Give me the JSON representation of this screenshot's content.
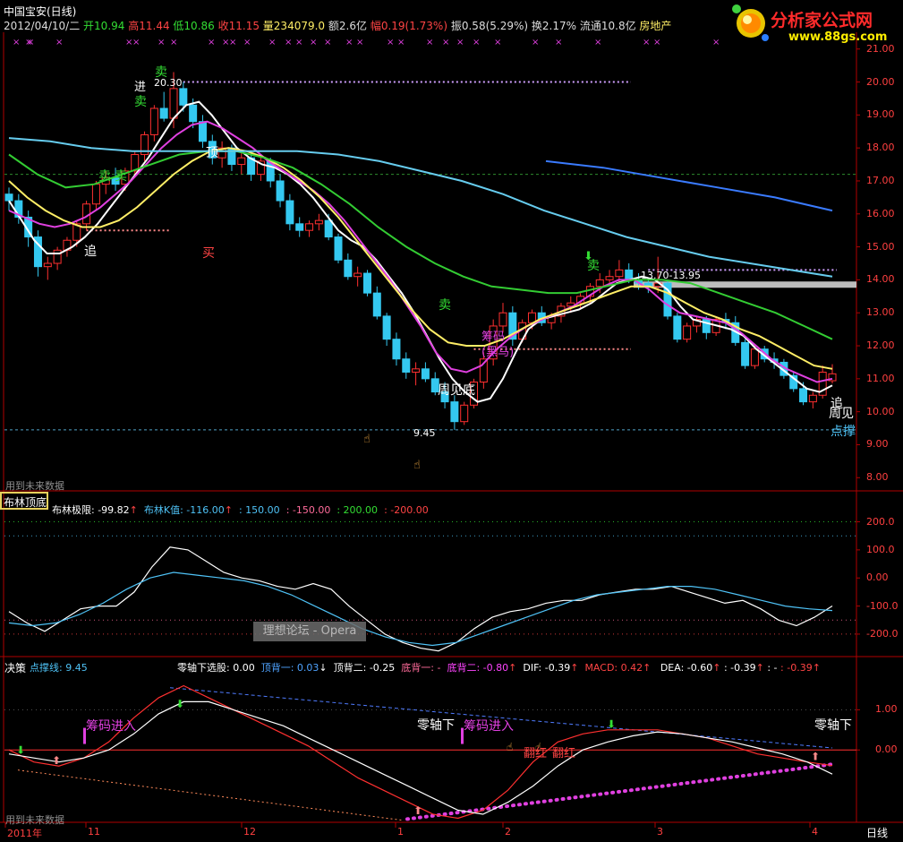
{
  "header": {
    "title": "中国宝安(日线)",
    "date": "2012/04/10/二",
    "open": "开10.94",
    "high": "高11.44",
    "low": "低10.86",
    "close": "收11.15",
    "volume": "量234079.0",
    "amount": "额2.6亿",
    "change": "幅0.19(1.73%)",
    "amplitude": "振0.58(5.29%)",
    "turnover": "换2.17%",
    "float": "流通10.8亿",
    "sector": "房地产"
  },
  "logo": {
    "brand": "分析家公式网",
    "url": "www.88gs.com"
  },
  "main_panel": {
    "y_ticks": [
      "21.00",
      "20.00",
      "19.00",
      "18.00",
      "17.00",
      "16.00",
      "15.00",
      "14.00",
      "13.00",
      "12.00",
      "11.00",
      "10.00",
      "9.00",
      "8.00"
    ],
    "future_data_note": "用到未来数据",
    "annotations": {
      "sell_labels": [
        "卖",
        "卖",
        "卖",
        "卖",
        "卖",
        "卖"
      ],
      "chase": "追",
      "chase_right": "追",
      "buy": "买",
      "top": "顶",
      "advance": "进",
      "weekly_bottom": "周见底",
      "weekly_right": "周见",
      "support_right": "点撑",
      "low_marker": "9.45",
      "high_marker": "20.30",
      "range_marker": "13.70-13.95",
      "chip_mid": "筹码",
      "chip_paren": "(黑马)"
    }
  },
  "indicator_panel": {
    "button_label": "布林顶底",
    "items": [
      {
        "label": "布林极限: -99.82",
        "color": "#ffffff"
      },
      {
        "label": "布林K值: -116.00",
        "color": "#4fc3f7"
      },
      {
        "label": ": 150.00",
        "color": "#4fc3f7"
      },
      {
        "label": ": -150.00",
        "color": "#ff6b9a"
      },
      {
        "label": ": 200.00",
        "color": "#33dd33"
      },
      {
        "label": ": -200.00",
        "color": "#ff4444"
      }
    ],
    "y_ticks": [
      "200.0",
      "100.0",
      "0.00",
      "-100.0",
      "-200.0"
    ],
    "watermark": "理想论坛 - Opera"
  },
  "decision_panel": {
    "title": "决策",
    "support": "点撑线: 9.45",
    "items": [
      {
        "label": "零轴下选股: 0.00",
        "color": "#ffffff"
      },
      {
        "label": "顶背一: 0.03",
        "color": "#4fa3ff"
      },
      {
        "label": "顶背二: -0.25",
        "color": "#ffffff"
      },
      {
        "label": "底背一: -",
        "color": "#ff6b9a"
      },
      {
        "label": "底背二: -0.80",
        "color": "#ff44ff"
      },
      {
        "label": "DIF: -0.39",
        "color": "#ffffff"
      },
      {
        "label": "MACD: 0.42",
        "color": "#ff4444"
      },
      {
        "label": "DEA: -0.60",
        "color": "#ffffff"
      },
      {
        "label": ": -0.39",
        "color": "#ffffff"
      },
      {
        "label": ": -",
        "color": "#ffffff"
      },
      {
        "label": ": -0.39",
        "color": "#ff4444"
      }
    ],
    "y_ticks": [
      "1.00",
      "0.00"
    ],
    "annotations": {
      "chip_in_1": "筹码进入",
      "chip_in_2": "筹码进入",
      "zero_below_1": "零轴下",
      "zero_below_2": "零轴下",
      "flip_red_1": "翻红",
      "flip_red_2": "翻红"
    },
    "future_data_note": "用到未来数据"
  },
  "x_axis": {
    "labels": [
      "2011年",
      "11",
      "12",
      "1",
      "2",
      "3",
      "4"
    ],
    "period": "日线"
  },
  "colors": {
    "up": "#ff3030",
    "down": "#34c8f0",
    "ma_white": "#ffffff",
    "ma_magenta": "#e040e0",
    "ma_yellow": "#ffee66",
    "ma_green": "#33cc33",
    "ma_lightblue": "#66ccee",
    "ma_blue": "#3a7bff",
    "axis": "#b00000"
  },
  "chart_data": [
    {
      "type": "candlestick",
      "title": "中国宝安(日线)",
      "ylim": [
        7.6,
        21.4
      ],
      "candles_ohlc": [
        [
          16.6,
          16.8,
          16.1,
          16.4
        ],
        [
          16.4,
          16.6,
          15.7,
          15.9
        ],
        [
          15.9,
          16.1,
          15.0,
          15.3
        ],
        [
          15.3,
          15.5,
          14.1,
          14.4
        ],
        [
          14.4,
          14.7,
          14.0,
          14.5
        ],
        [
          14.5,
          15.0,
          14.3,
          14.9
        ],
        [
          14.9,
          15.3,
          14.7,
          15.2
        ],
        [
          15.2,
          15.8,
          15.0,
          15.7
        ],
        [
          15.7,
          16.4,
          15.5,
          16.3
        ],
        [
          16.3,
          17.0,
          16.1,
          16.9
        ],
        [
          16.9,
          17.3,
          16.6,
          17.1
        ],
        [
          17.1,
          17.4,
          16.7,
          16.9
        ],
        [
          16.9,
          17.4,
          16.7,
          17.3
        ],
        [
          17.3,
          17.9,
          17.1,
          17.8
        ],
        [
          17.8,
          18.5,
          17.6,
          18.4
        ],
        [
          18.4,
          19.3,
          18.2,
          19.2
        ],
        [
          19.2,
          19.7,
          18.8,
          18.9
        ],
        [
          18.9,
          20.3,
          18.6,
          19.8
        ],
        [
          19.8,
          20.0,
          19.1,
          19.3
        ],
        [
          19.3,
          19.5,
          18.6,
          18.8
        ],
        [
          18.8,
          19.0,
          18.0,
          18.2
        ],
        [
          18.2,
          18.4,
          17.5,
          17.7
        ],
        [
          17.7,
          18.2,
          17.4,
          18.0
        ],
        [
          18.0,
          18.1,
          17.3,
          17.5
        ],
        [
          17.5,
          17.9,
          17.2,
          17.7
        ],
        [
          17.7,
          17.9,
          17.0,
          17.2
        ],
        [
          17.2,
          17.8,
          17.0,
          17.6
        ],
        [
          17.6,
          17.7,
          16.8,
          17.0
        ],
        [
          17.0,
          17.2,
          16.2,
          16.4
        ],
        [
          16.4,
          16.6,
          15.5,
          15.7
        ],
        [
          15.7,
          15.9,
          15.3,
          15.5
        ],
        [
          15.5,
          15.8,
          15.3,
          15.7
        ],
        [
          15.7,
          16.0,
          15.5,
          15.8
        ],
        [
          15.8,
          16.0,
          15.2,
          15.3
        ],
        [
          15.3,
          15.4,
          14.5,
          14.6
        ],
        [
          14.6,
          14.8,
          14.0,
          14.1
        ],
        [
          14.1,
          14.4,
          13.8,
          14.2
        ],
        [
          14.2,
          14.3,
          13.5,
          13.6
        ],
        [
          13.6,
          13.8,
          12.8,
          12.9
        ],
        [
          12.9,
          13.0,
          12.0,
          12.2
        ],
        [
          12.2,
          12.4,
          11.4,
          11.6
        ],
        [
          11.6,
          11.8,
          11.0,
          11.2
        ],
        [
          11.2,
          11.5,
          10.8,
          11.3
        ],
        [
          11.3,
          11.5,
          10.9,
          11.0
        ],
        [
          11.0,
          11.2,
          10.5,
          10.6
        ],
        [
          10.6,
          10.9,
          10.1,
          10.3
        ],
        [
          10.3,
          10.5,
          9.45,
          9.7
        ],
        [
          9.7,
          10.3,
          9.6,
          10.2
        ],
        [
          10.2,
          11.0,
          10.1,
          10.9
        ],
        [
          10.9,
          11.8,
          10.7,
          11.6
        ],
        [
          11.6,
          12.8,
          11.4,
          12.6
        ],
        [
          12.6,
          13.3,
          12.4,
          13.0
        ],
        [
          13.0,
          13.2,
          12.0,
          12.2
        ],
        [
          12.2,
          12.8,
          12.1,
          12.7
        ],
        [
          12.7,
          13.1,
          12.5,
          13.0
        ],
        [
          13.0,
          13.2,
          12.6,
          12.7
        ],
        [
          12.7,
          13.0,
          12.5,
          12.9
        ],
        [
          12.9,
          13.3,
          12.7,
          13.2
        ],
        [
          13.2,
          13.5,
          13.0,
          13.3
        ],
        [
          13.3,
          13.6,
          13.1,
          13.5
        ],
        [
          13.5,
          13.9,
          13.3,
          13.8
        ],
        [
          13.8,
          14.2,
          13.6,
          14.0
        ],
        [
          14.0,
          14.3,
          13.8,
          14.1
        ],
        [
          14.1,
          14.6,
          13.9,
          14.3
        ],
        [
          14.3,
          14.5,
          13.9,
          14.0
        ],
        [
          14.0,
          14.2,
          13.7,
          13.9
        ],
        [
          13.9,
          14.0,
          13.6,
          13.8
        ],
        [
          13.8,
          14.7,
          13.6,
          13.9
        ],
        [
          13.9,
          14.0,
          12.8,
          12.9
        ],
        [
          12.9,
          13.0,
          12.1,
          12.2
        ],
        [
          12.2,
          12.7,
          12.1,
          12.6
        ],
        [
          12.6,
          12.9,
          12.4,
          12.8
        ],
        [
          12.8,
          12.9,
          12.2,
          12.4
        ],
        [
          12.4,
          12.9,
          12.3,
          12.8
        ],
        [
          12.8,
          13.0,
          12.5,
          12.7
        ],
        [
          12.7,
          12.9,
          12.0,
          12.1
        ],
        [
          12.1,
          12.2,
          11.3,
          11.4
        ],
        [
          11.4,
          12.0,
          11.3,
          11.9
        ],
        [
          11.9,
          12.0,
          11.5,
          11.6
        ],
        [
          11.6,
          11.8,
          11.3,
          11.5
        ],
        [
          11.5,
          11.6,
          11.0,
          11.1
        ],
        [
          11.1,
          11.2,
          10.6,
          10.7
        ],
        [
          10.7,
          10.9,
          10.2,
          10.3
        ],
        [
          10.3,
          10.6,
          10.1,
          10.5
        ],
        [
          10.5,
          11.4,
          10.4,
          11.2
        ],
        [
          10.94,
          11.44,
          10.86,
          11.15
        ]
      ],
      "moving_averages": [
        {
          "color": "white",
          "values": [
            16.4,
            15.8,
            15.2,
            14.8,
            14.8,
            15.0,
            15.3,
            15.7,
            16.2,
            16.7,
            17.2,
            17.7,
            18.3,
            18.9,
            19.3,
            19.4,
            19.0,
            18.5,
            18.0,
            17.7,
            17.5,
            17.4,
            17.2,
            16.9,
            16.5,
            16.0,
            15.5,
            15.2,
            15.0,
            14.6,
            14.1,
            13.6,
            13.0,
            12.3,
            11.6,
            11.0,
            10.6,
            10.3,
            10.4,
            11.0,
            11.8,
            12.5,
            12.8,
            12.9,
            13.0,
            13.1,
            13.3,
            13.6,
            13.9,
            14.0,
            14.1,
            14.0,
            13.7,
            13.2,
            12.8,
            12.7,
            12.6,
            12.5,
            12.3,
            11.9,
            11.6,
            11.3,
            11.0,
            10.7,
            10.6,
            10.8
          ]
        },
        {
          "color": "magenta",
          "values": [
            16.1,
            15.9,
            15.7,
            15.6,
            15.7,
            15.9,
            16.2,
            16.6,
            17.0,
            17.5,
            18.0,
            18.4,
            18.7,
            18.8,
            18.6,
            18.3,
            18.0,
            17.6,
            17.3,
            17.0,
            16.7,
            16.3,
            15.8,
            15.2,
            14.6,
            14.0,
            13.3,
            12.6,
            11.8,
            11.3,
            11.2,
            11.4,
            11.9,
            12.3,
            12.6,
            12.8,
            13.0,
            13.2,
            13.5,
            13.8,
            14.0,
            14.0,
            13.7,
            13.3,
            13.0,
            12.9,
            12.8,
            12.7,
            12.4,
            12.0,
            11.6,
            11.3,
            11.1,
            10.9,
            11.0
          ]
        },
        {
          "color": "yellow",
          "values": [
            17.0,
            16.5,
            16.1,
            15.8,
            15.6,
            15.6,
            15.8,
            16.2,
            16.7,
            17.2,
            17.6,
            17.9,
            18.0,
            17.9,
            17.7,
            17.4,
            17.0,
            16.5,
            15.9,
            15.2,
            14.5,
            13.8,
            13.1,
            12.5,
            12.1,
            12.0,
            12.0,
            12.2,
            12.5,
            12.8,
            13.0,
            13.2,
            13.4,
            13.6,
            13.8,
            13.8,
            13.6,
            13.3,
            13.0,
            12.8,
            12.5,
            12.3,
            12.0,
            11.7,
            11.4,
            11.3
          ]
        },
        {
          "color": "green",
          "values": [
            17.8,
            17.2,
            16.8,
            16.9,
            17.2,
            17.5,
            17.8,
            17.9,
            17.9,
            17.7,
            17.4,
            16.9,
            16.3,
            15.6,
            15.0,
            14.5,
            14.1,
            13.8,
            13.7,
            13.6,
            13.6,
            13.8,
            14.0,
            14.0,
            13.9,
            13.6,
            13.3,
            13.0,
            12.6,
            12.2
          ]
        },
        {
          "color": "lightblue",
          "values": [
            18.3,
            18.2,
            18.0,
            17.9,
            17.9,
            17.9,
            17.9,
            17.9,
            17.8,
            17.6,
            17.3,
            17.0,
            16.6,
            16.1,
            15.7,
            15.3,
            15.0,
            14.7,
            14.5,
            14.3,
            14.1
          ]
        },
        {
          "color": "blue",
          "values": [
            17.6,
            17.4,
            17.1,
            16.8,
            16.5,
            16.1
          ]
        }
      ]
    },
    {
      "type": "line",
      "title": "布林顶底",
      "ylim": [
        -280,
        240
      ],
      "series": [
        {
          "name": "布林极限",
          "values": [
            -120,
            -160,
            -190,
            -150,
            -110,
            -100,
            -100,
            -50,
            40,
            110,
            100,
            60,
            20,
            0,
            -10,
            -30,
            -40,
            -20,
            -40,
            -100,
            -150,
            -200,
            -230,
            -250,
            -260,
            -230,
            -180,
            -140,
            -120,
            -110,
            -90,
            -80,
            -80,
            -60,
            -50,
            -40,
            -40,
            -30,
            -50,
            -70,
            -90,
            -80,
            -110,
            -150,
            -170,
            -140,
            -99.82
          ]
        },
        {
          "name": "布林K值",
          "values": [
            -160,
            -170,
            -160,
            -130,
            -90,
            -40,
            0,
            20,
            10,
            0,
            -10,
            -30,
            -60,
            -100,
            -140,
            -180,
            -210,
            -230,
            -240,
            -230,
            -200,
            -170,
            -140,
            -110,
            -80,
            -60,
            -50,
            -40,
            -30,
            -30,
            -40,
            -60,
            -80,
            -100,
            -110,
            -116
          ]
        }
      ],
      "reference_lines": [
        200,
        -200,
        150,
        -150
      ]
    },
    {
      "type": "line",
      "title": "决策",
      "ylim": [
        -1.8,
        1.9
      ],
      "series": [
        {
          "name": "DIF",
          "values": [
            0.0,
            -0.3,
            -0.4,
            -0.2,
            0.2,
            0.8,
            1.3,
            1.6,
            1.3,
            1.0,
            0.7,
            0.4,
            0.1,
            -0.3,
            -0.7,
            -1.0,
            -1.3,
            -1.6,
            -1.7,
            -1.5,
            -1.0,
            -0.3,
            0.2,
            0.4,
            0.5,
            0.5,
            0.5,
            0.4,
            0.3,
            0.1,
            -0.1,
            -0.2,
            -0.3,
            -0.39
          ]
        },
        {
          "name": "DEA",
          "values": [
            -0.1,
            -0.2,
            -0.3,
            -0.2,
            0.0,
            0.4,
            0.9,
            1.2,
            1.2,
            1.0,
            0.8,
            0.6,
            0.3,
            0.0,
            -0.3,
            -0.6,
            -0.9,
            -1.2,
            -1.5,
            -1.6,
            -1.3,
            -0.9,
            -0.4,
            0.0,
            0.2,
            0.35,
            0.45,
            0.4,
            0.3,
            0.2,
            0.05,
            -0.1,
            -0.3,
            -0.6
          ]
        }
      ],
      "support_value": 9.45
    }
  ]
}
